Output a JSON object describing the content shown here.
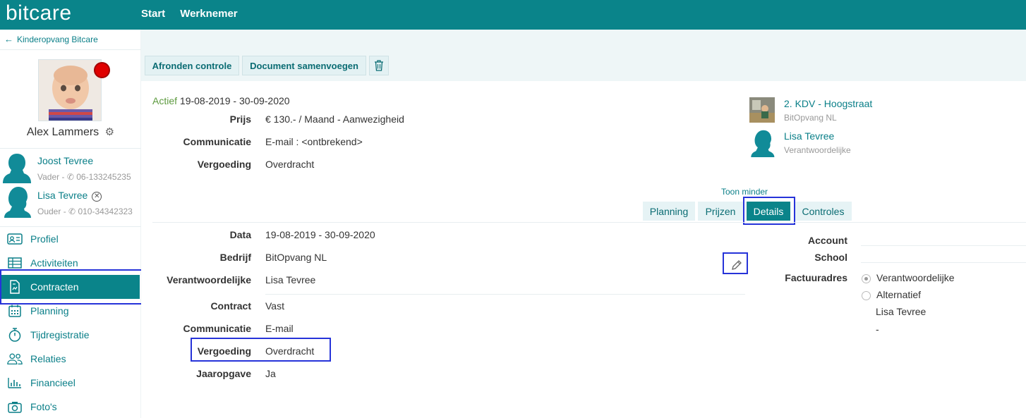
{
  "app": {
    "brand": "bitcare",
    "nav": [
      "Start",
      "Werknemer"
    ]
  },
  "sidebar": {
    "back_label": "Kinderopvang Bitcare",
    "child_name": "Alex Lammers",
    "parents": [
      {
        "name": "Joost Tevree",
        "role": "Vader",
        "phone": "06-133245235"
      },
      {
        "name": "Lisa Tevree",
        "role": "Ouder",
        "phone": "010-34342323"
      }
    ],
    "menu": [
      {
        "label": "Profiel",
        "icon": "id-card-icon"
      },
      {
        "label": "Activiteiten",
        "icon": "table-icon"
      },
      {
        "label": "Contracten",
        "icon": "document-icon",
        "active": true
      },
      {
        "label": "Planning",
        "icon": "calendar-icon"
      },
      {
        "label": "Tijdregistratie",
        "icon": "stopwatch-icon"
      },
      {
        "label": "Relaties",
        "icon": "people-icon"
      },
      {
        "label": "Financieel",
        "icon": "bar-chart-icon"
      },
      {
        "label": "Foto's",
        "icon": "camera-icon"
      }
    ]
  },
  "toolbar": {
    "afronden_label": "Afronden controle",
    "samenvoegen_label": "Document samenvoegen"
  },
  "contract": {
    "status": "Actief",
    "period": "19-08-2019 - 30-09-2020",
    "summary": [
      {
        "label": "Prijs",
        "value": "€ 130.- / Maand - Aanwezigheid"
      },
      {
        "label": "Communicatie",
        "value": "E-mail : <ontbrekend>"
      },
      {
        "label": "Vergoeding",
        "value": "Overdracht"
      }
    ],
    "location": {
      "title": "2. KDV - Hoogstraat",
      "subtitle": "BitOpvang NL"
    },
    "responsible": {
      "title": "Lisa Tevree",
      "subtitle": "Verantwoordelijke"
    },
    "toon_minder": "Toon minder",
    "tabs": [
      "Planning",
      "Prijzen",
      "Details",
      "Controles"
    ],
    "active_tab": "Details",
    "details": [
      {
        "label": "Data",
        "value": "19-08-2019 - 30-09-2020"
      },
      {
        "label": "Bedrijf",
        "value": "BitOpvang NL"
      },
      {
        "label": "Verantwoordelijke",
        "value": "Lisa Tevree"
      },
      {
        "label": "Contract",
        "value": "Vast"
      },
      {
        "label": "Communicatie",
        "value": "E-mail"
      },
      {
        "label": "Vergoeding",
        "value": "Overdracht"
      },
      {
        "label": "Jaaropgave",
        "value": "Ja"
      }
    ],
    "right": {
      "account_label": "Account",
      "school_label": "School",
      "factuuradres_label": "Factuuradres",
      "options": [
        "Verantwoordelijke",
        "Alternatief"
      ],
      "selected_option": "Verantwoordelijke",
      "address_name": "Lisa Tevree",
      "address_extra": "-"
    }
  },
  "colors": {
    "primary": "#0a848a",
    "link": "#0a7f88",
    "status_active": "#5d9a3f",
    "highlight": "#2633d9",
    "status_dot": "#e00000"
  }
}
